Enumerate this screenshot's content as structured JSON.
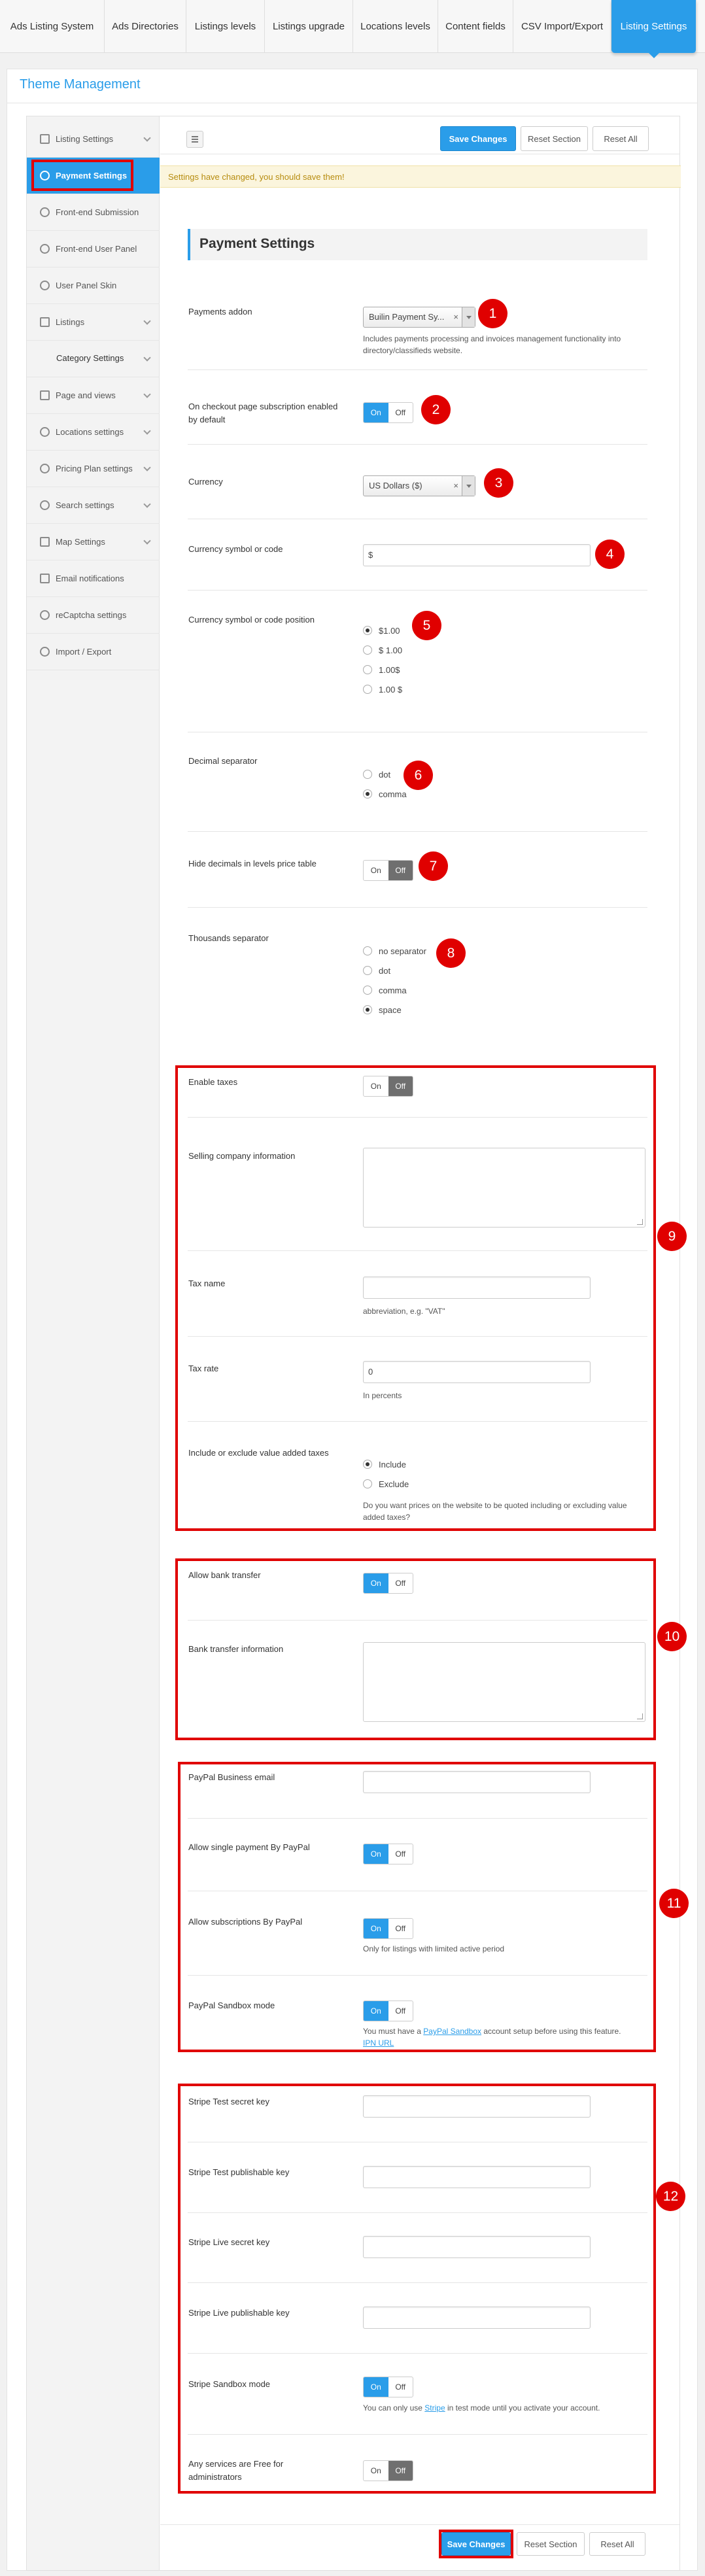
{
  "top_tabs": [
    "Ads Listing System",
    "Ads Directories",
    "Listings levels",
    "Listings upgrade",
    "Locations levels",
    "Content fields",
    "CSV Import/Export",
    "Listing Settings"
  ],
  "page_title": "Theme Management",
  "sidebar": {
    "items": [
      {
        "label": "Listing Settings",
        "icon": "list-icon"
      },
      {
        "label": "Payment Settings",
        "icon": "gear-icon"
      },
      {
        "label": "Front-end Submission",
        "icon": "car-icon"
      },
      {
        "label": "Front-end User Panel",
        "icon": "car-icon"
      },
      {
        "label": "User Panel Skin",
        "icon": "car-icon"
      },
      {
        "label": "Listings",
        "icon": "edit-icon"
      },
      {
        "label": "Category Settings",
        "icon": ""
      },
      {
        "label": "Page and views",
        "icon": "image-icon"
      },
      {
        "label": "Locations settings",
        "icon": "gear-icon"
      },
      {
        "label": "Pricing Plan settings",
        "icon": "car-icon"
      },
      {
        "label": "Search settings",
        "icon": "search-icon"
      },
      {
        "label": "Map Settings",
        "icon": "map-icon"
      },
      {
        "label": "Email notifications",
        "icon": "mail-icon"
      },
      {
        "label": "reCaptcha settings",
        "icon": "refresh-icon"
      },
      {
        "label": "Import / Export",
        "icon": "refresh-icon"
      }
    ]
  },
  "toolbar": {
    "save": "Save Changes",
    "reset_section": "Reset Section",
    "reset_all": "Reset All"
  },
  "notice": "Settings have changed, you should save them!",
  "section_title": "Payment Settings",
  "fields": {
    "payments_addon": {
      "label": "Payments addon",
      "value": "Builin Payment Sy...",
      "desc": "Includes payments processing and invoices management functionality into directory/classifieds website."
    },
    "checkout_sub": {
      "label": "On checkout page subscription enabled by default"
    },
    "currency": {
      "label": "Currency",
      "value": "US Dollars ($)"
    },
    "symbol": {
      "label": "Currency symbol or code",
      "value": "$"
    },
    "symbol_pos": {
      "label": "Currency symbol or code position",
      "options": [
        "$1.00",
        "$ 1.00",
        "1.00$",
        "1.00 $"
      ]
    },
    "decimal": {
      "label": "Decimal separator",
      "options": [
        "dot",
        "comma"
      ]
    },
    "hide_dec": {
      "label": "Hide decimals in levels price table"
    },
    "thousands": {
      "label": "Thousands separator",
      "options": [
        "no separator",
        "dot",
        "comma",
        "space"
      ]
    },
    "enable_taxes": {
      "label": "Enable taxes"
    },
    "company_info": {
      "label": "Selling company information"
    },
    "tax_name": {
      "label": "Tax name",
      "desc": "abbreviation, e.g. \"VAT\""
    },
    "tax_rate": {
      "label": "Tax rate",
      "value": "0",
      "desc": "In percents"
    },
    "vat": {
      "label": "Include or exclude value added taxes",
      "options": [
        "Include",
        "Exclude"
      ],
      "desc": "Do you want prices on the website to be quoted including or excluding value added taxes?"
    },
    "bank": {
      "label": "Allow bank transfer"
    },
    "bank_info": {
      "label": "Bank transfer information"
    },
    "paypal_email": {
      "label": "PayPal Business email"
    },
    "paypal_single": {
      "label": "Allow single payment By PayPal"
    },
    "paypal_subs": {
      "label": "Allow subscriptions By PayPal",
      "desc": "Only for listings with limited active period"
    },
    "paypal_sandbox": {
      "label": "PayPal Sandbox mode",
      "desc1": "You must have a ",
      "link1": "PayPal Sandbox",
      "desc2": " account setup before using this feature.",
      "link2": "IPN URL"
    },
    "stripe_test_secret": {
      "label": "Stripe Test secret key"
    },
    "stripe_test_pub": {
      "label": "Stripe Test publishable key"
    },
    "stripe_live_secret": {
      "label": "Stripe Live secret key"
    },
    "stripe_live_pub": {
      "label": "Stripe Live publishable key"
    },
    "stripe_sandbox": {
      "label": "Stripe Sandbox mode",
      "desc1": "You can only use ",
      "link": "Stripe",
      "desc2": " in test mode until you activate your account."
    },
    "free_admin": {
      "label": "Any services are Free for administrators"
    }
  },
  "toggle": {
    "on": "On",
    "off": "Off"
  },
  "badges": [
    "1",
    "2",
    "3",
    "4",
    "5",
    "6",
    "7",
    "8",
    "9",
    "10",
    "11",
    "12"
  ],
  "colors": {
    "accent": "#2a9de9",
    "highlight": "#e00000",
    "notice_bg": "#fbf5dd"
  }
}
